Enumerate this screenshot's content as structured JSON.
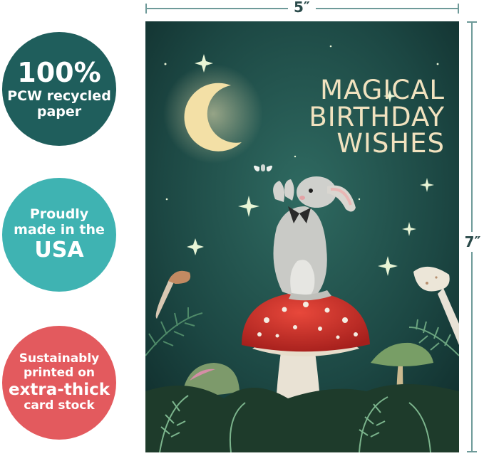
{
  "badges": [
    {
      "lines": [
        "100%",
        "PCW recycled",
        "paper"
      ],
      "color": "#1f5e5c"
    },
    {
      "lines": [
        "Proudly",
        "made in the",
        "USA"
      ],
      "color": "#3fb3b2"
    },
    {
      "lines": [
        "Sustainably",
        "printed on",
        "extra-thick",
        "card stock"
      ],
      "color": "#e35a5e"
    }
  ],
  "dimensions": {
    "width_label": "5″",
    "height_label": "7″"
  },
  "card": {
    "title_lines": [
      "MAGICAL",
      "BIRTHDAY",
      "WISHES"
    ],
    "background_color": "#1d4a45",
    "title_color": "#f1e2bf"
  }
}
